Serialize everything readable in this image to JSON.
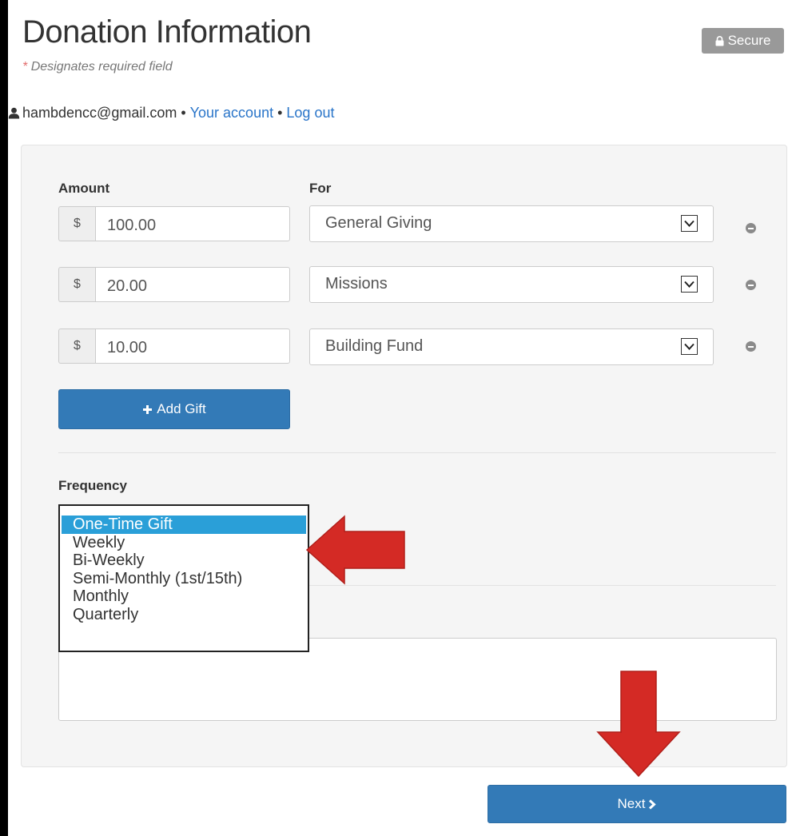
{
  "header": {
    "title": "Donation Information",
    "required_star": "*",
    "required_note": "Designates required field",
    "secure_label": "Secure"
  },
  "user": {
    "email": "hambdencc@gmail.com",
    "separator": "•",
    "account_link": "Your account",
    "logout_link": "Log out"
  },
  "gifts": {
    "amount_label": "Amount",
    "for_label": "For",
    "currency_symbol": "$",
    "rows": [
      {
        "amount": "100.00",
        "fund": "General Giving"
      },
      {
        "amount": "20.00",
        "fund": "Missions"
      },
      {
        "amount": "10.00",
        "fund": "Building Fund"
      }
    ],
    "add_gift_label": "Add Gift"
  },
  "frequency": {
    "label": "Frequency",
    "options": [
      "One-Time Gift",
      "Weekly",
      "Bi-Weekly",
      "Semi-Monthly (1st/15th)",
      "Monthly",
      "Quarterly"
    ],
    "selected": "One-Time Gift"
  },
  "footer": {
    "next_label": "Next"
  },
  "colors": {
    "primary_button": "#337ab7",
    "selected_option": "#2a9fd8",
    "annotation_arrow": "#d42a25",
    "secure_badge": "#999999",
    "link": "#2a75c9"
  },
  "icons": [
    "lock-icon",
    "user-icon",
    "plus-icon",
    "minus-circle-icon",
    "select-arrow-icon",
    "chevron-right-icon",
    "red-arrow-left-icon",
    "red-arrow-down-icon"
  ]
}
